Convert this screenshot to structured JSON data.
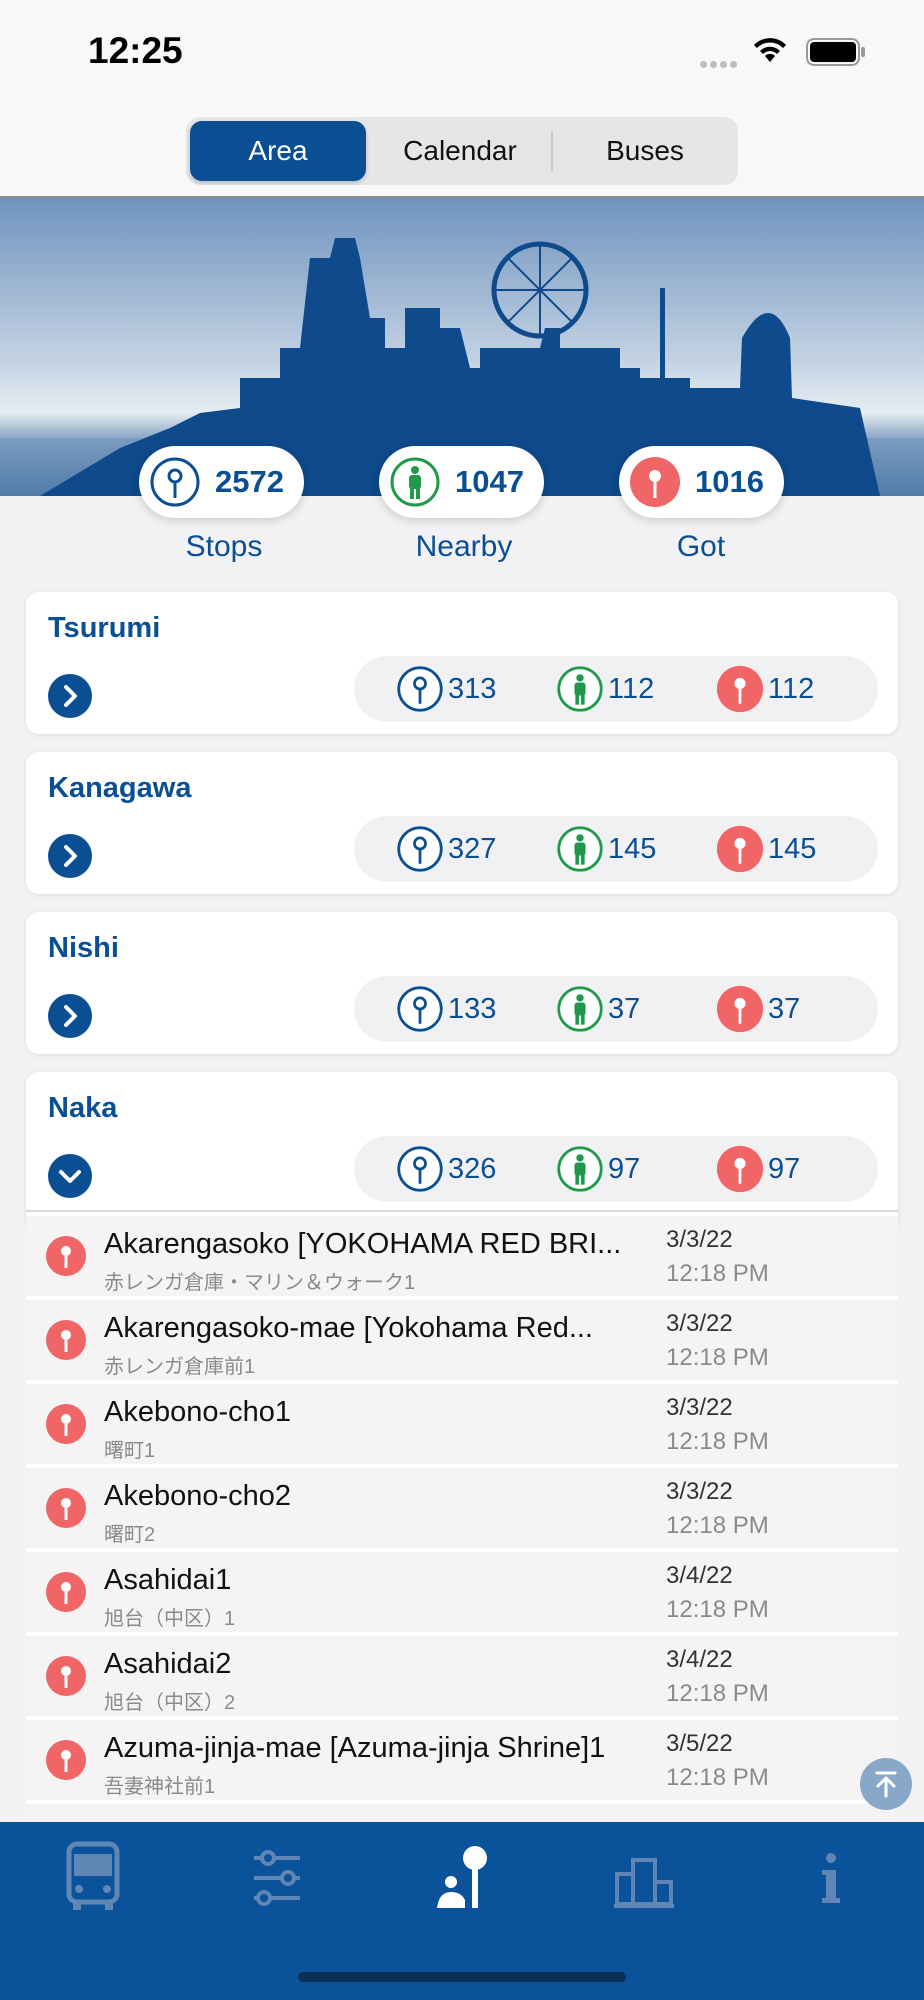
{
  "status_bar": {
    "time": "12:25"
  },
  "segments": [
    {
      "label": "Area",
      "active": true
    },
    {
      "label": "Calendar",
      "active": false
    },
    {
      "label": "Buses",
      "active": false
    }
  ],
  "summary": {
    "stops": {
      "count": "2572",
      "label": "Stops",
      "icon": "stop-pin-icon"
    },
    "nearby": {
      "count": "1047",
      "label": "Nearby",
      "icon": "person-icon"
    },
    "got": {
      "count": "1016",
      "label": "Got",
      "icon": "got-pin-icon"
    }
  },
  "areas": [
    {
      "name": "Tsurumi",
      "stops": "313",
      "nearby": "112",
      "got": "112",
      "expanded": false
    },
    {
      "name": "Kanagawa",
      "stops": "327",
      "nearby": "145",
      "got": "145",
      "expanded": false
    },
    {
      "name": "Nishi",
      "stops": "133",
      "nearby": "37",
      "got": "37",
      "expanded": false
    },
    {
      "name": "Naka",
      "stops": "326",
      "nearby": "97",
      "got": "97",
      "expanded": true
    }
  ],
  "stops": [
    {
      "title": "Akarengasoko [YOKOHAMA RED BRI...",
      "subtitle": "赤レンガ倉庫・マリン＆ウォーク1",
      "date": "3/3/22",
      "time": "12:18 PM"
    },
    {
      "title": "Akarengasoko-mae [Yokohama Red...",
      "subtitle": "赤レンガ倉庫前1",
      "date": "3/3/22",
      "time": "12:18 PM"
    },
    {
      "title": "Akebono-cho1",
      "subtitle": "曙町1",
      "date": "3/3/22",
      "time": "12:18 PM"
    },
    {
      "title": "Akebono-cho2",
      "subtitle": "曙町2",
      "date": "3/3/22",
      "time": "12:18 PM"
    },
    {
      "title": "Asahidai1",
      "subtitle": "旭台（中区）1",
      "date": "3/4/22",
      "time": "12:18 PM"
    },
    {
      "title": "Asahidai2",
      "subtitle": "旭台（中区）2",
      "date": "3/4/22",
      "time": "12:18 PM"
    },
    {
      "title": "Azuma-jinja-mae [Azuma-jinja Shrine]1",
      "subtitle": "吾妻神社前1",
      "date": "3/5/22",
      "time": "12:18 PM"
    }
  ],
  "tabs": [
    {
      "icon": "bus-icon",
      "active": false
    },
    {
      "icon": "route-icon",
      "active": false
    },
    {
      "icon": "stop-collector-icon",
      "active": true
    },
    {
      "icon": "ranking-icon",
      "active": false
    },
    {
      "icon": "info-icon",
      "active": false
    }
  ],
  "colors": {
    "primary": "#0a4f93",
    "nearby": "#1f9a4a",
    "got": "#f06565",
    "tabbar": "#0a5299"
  }
}
